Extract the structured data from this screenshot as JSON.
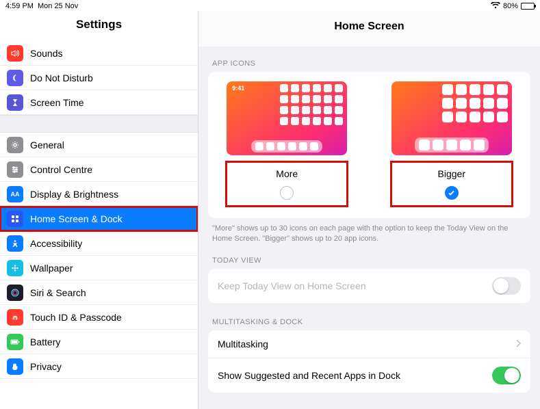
{
  "status": {
    "time": "4:59 PM",
    "date": "Mon 25 Nov",
    "battery_pct": "80%"
  },
  "sidebar": {
    "title": "Settings",
    "items": [
      {
        "label": "Sounds"
      },
      {
        "label": "Do Not Disturb"
      },
      {
        "label": "Screen Time"
      },
      {
        "label": "General"
      },
      {
        "label": "Control Centre"
      },
      {
        "label": "Display & Brightness"
      },
      {
        "label": "Home Screen & Dock"
      },
      {
        "label": "Accessibility"
      },
      {
        "label": "Wallpaper"
      },
      {
        "label": "Siri & Search"
      },
      {
        "label": "Touch ID & Passcode"
      },
      {
        "label": "Battery"
      },
      {
        "label": "Privacy"
      }
    ]
  },
  "detail": {
    "title": "Home Screen",
    "sections": {
      "app_icons_header": "APP ICONS",
      "options": {
        "more": {
          "label": "More",
          "preview_clock": "9:41",
          "selected": false
        },
        "bigger": {
          "label": "Bigger",
          "selected": true
        }
      },
      "footnote": "\"More\" shows up to 30 icons on each page with the option to keep the Today View on the Home Screen. \"Bigger\" shows up to 20 app icons.",
      "today_view_header": "TODAY VIEW",
      "today_view_row": "Keep Today View on Home Screen",
      "today_view_enabled": false,
      "multitasking_header": "MULTITASKING & DOCK",
      "multitasking_row": "Multitasking",
      "suggested_row": "Show Suggested and Recent Apps in Dock",
      "suggested_on": true
    }
  }
}
